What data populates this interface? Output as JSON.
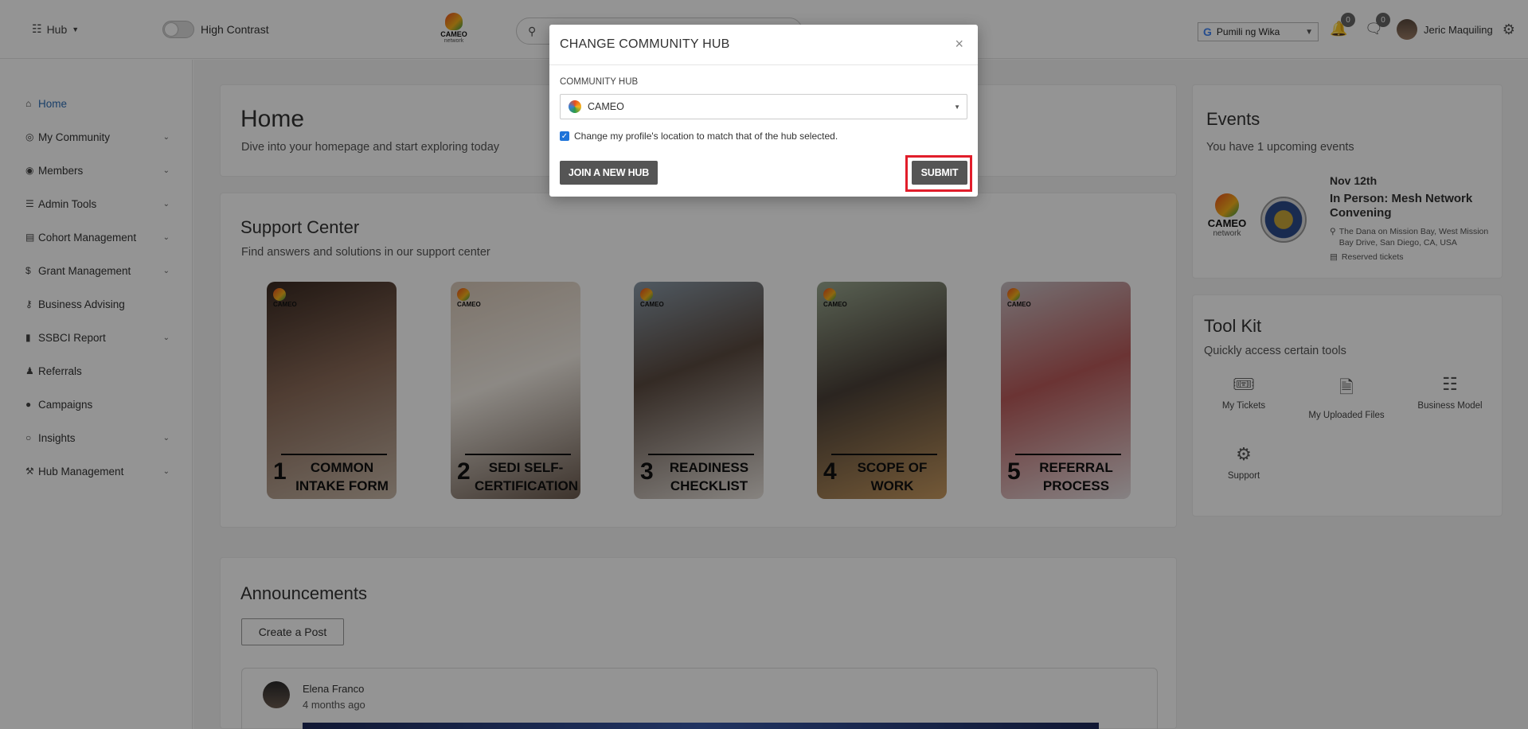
{
  "topbar": {
    "hub_label": "Hub",
    "high_contrast_label": "High Contrast",
    "logo_text": "CAMEO",
    "logo_subtext": "network",
    "translate_label": "Pumili ng Wika",
    "notifications_count": "0",
    "messages_count": "0",
    "user_name": "Jeric Maquiling"
  },
  "sidebar": {
    "items": [
      {
        "label": "Home",
        "icon": "home-icon"
      },
      {
        "label": "My Community",
        "icon": "community-icon"
      },
      {
        "label": "Members",
        "icon": "user-circle-icon"
      },
      {
        "label": "Admin Tools",
        "icon": "list-icon"
      },
      {
        "label": "Cohort Management",
        "icon": "card-icon"
      },
      {
        "label": "Grant Management",
        "icon": "dollar-icon"
      },
      {
        "label": "Business Advising",
        "icon": "key-icon"
      },
      {
        "label": "SSBCI Report",
        "icon": "file-icon"
      },
      {
        "label": "Referrals",
        "icon": "user-plus-icon"
      },
      {
        "label": "Campaigns",
        "icon": "comment-icon"
      },
      {
        "label": "Insights",
        "icon": "lightbulb-icon"
      },
      {
        "label": "Hub Management",
        "icon": "wrench-icon"
      }
    ]
  },
  "home": {
    "title": "Home",
    "subtitle": "Dive into your homepage and start exploring today"
  },
  "support": {
    "title": "Support Center",
    "subtitle": "Find answers and solutions in our support center",
    "tiles": [
      {
        "num": "1",
        "label": "COMMON INTAKE FORM"
      },
      {
        "num": "2",
        "label": "SEDI SELF-CERTIFICATION"
      },
      {
        "num": "3",
        "label": "READINESS CHECKLIST"
      },
      {
        "num": "4",
        "label": "SCOPE OF WORK"
      },
      {
        "num": "5",
        "label": "REFERRAL PROCESS"
      }
    ]
  },
  "announcements": {
    "title": "Announcements",
    "create_label": "Create a Post",
    "post_author": "Elena Franco",
    "post_time": "4 months ago"
  },
  "events": {
    "title": "Events",
    "subtitle": "You have 1 upcoming events",
    "date": "Nov 12th",
    "name": "In Person: Mesh Network Convening",
    "location": "The Dana on Mission Bay, West Mission Bay Drive, San Diego, CA, USA",
    "tickets": "Reserved tickets"
  },
  "toolkit": {
    "title": "Tool Kit",
    "subtitle": "Quickly access certain tools",
    "tools": [
      {
        "label": "My Tickets",
        "icon": "ticket-icon"
      },
      {
        "label": "My Uploaded Files",
        "icon": "upload-file-icon"
      },
      {
        "label": "Business Model",
        "icon": "network-icon"
      },
      {
        "label": "Support",
        "icon": "support-hand-icon"
      }
    ]
  },
  "modal": {
    "title": "CHANGE COMMUNITY HUB",
    "field_label": "COMMUNITY HUB",
    "selected_hub": "CAMEO",
    "checkbox_label": "Change my profile's location to match that of the hub selected.",
    "join_label": "JOIN A NEW HUB",
    "submit_label": "SUBMIT"
  }
}
